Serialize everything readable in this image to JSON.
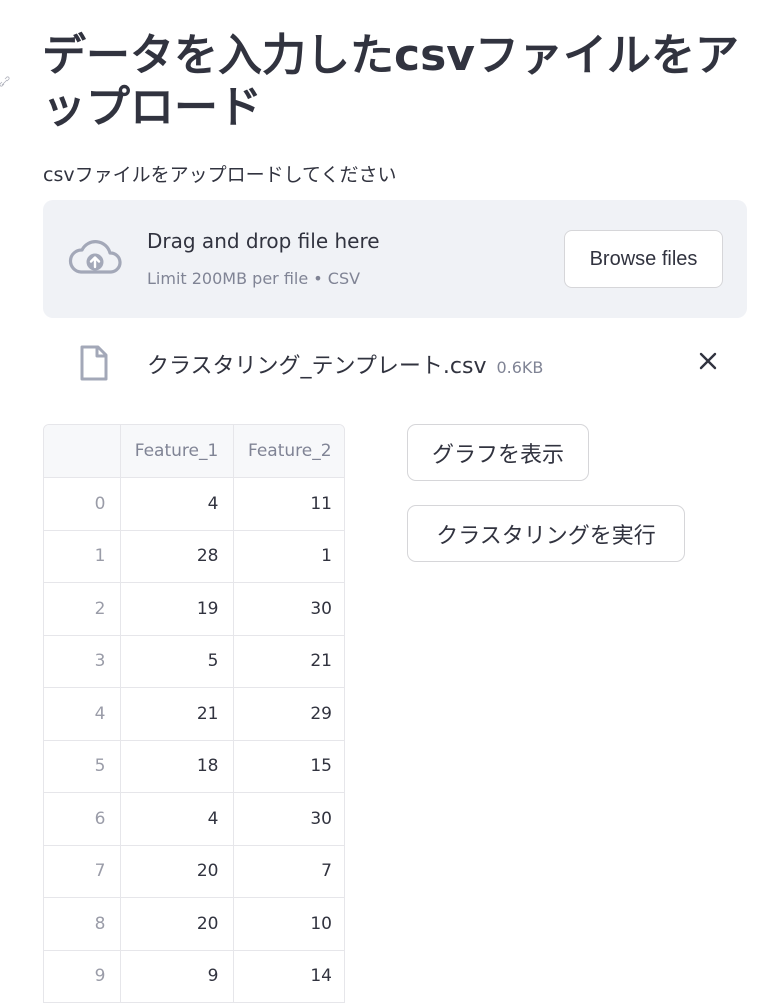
{
  "page": {
    "title": "データを入力したcsvファイルをアップロード"
  },
  "uploader": {
    "label": "csvファイルをアップロードしてください",
    "dropzone_title": "Drag and drop file here",
    "dropzone_limit": "Limit 200MB per file • CSV",
    "browse_label": "Browse files",
    "icon": "cloud-upload-icon"
  },
  "uploaded_file": {
    "name": "クラスタリング_テンプレート.csv",
    "size": "0.6KB",
    "icon": "file-icon",
    "remove_icon": "close-icon"
  },
  "dataframe": {
    "columns": [
      "",
      "Feature_1",
      "Feature_2"
    ],
    "rows": [
      {
        "index": "0",
        "feature_1": "4",
        "feature_2": "11"
      },
      {
        "index": "1",
        "feature_1": "28",
        "feature_2": "1"
      },
      {
        "index": "2",
        "feature_1": "19",
        "feature_2": "30"
      },
      {
        "index": "3",
        "feature_1": "5",
        "feature_2": "21"
      },
      {
        "index": "4",
        "feature_1": "21",
        "feature_2": "29"
      },
      {
        "index": "5",
        "feature_1": "18",
        "feature_2": "15"
      },
      {
        "index": "6",
        "feature_1": "4",
        "feature_2": "30"
      },
      {
        "index": "7",
        "feature_1": "20",
        "feature_2": "7"
      },
      {
        "index": "8",
        "feature_1": "20",
        "feature_2": "10"
      },
      {
        "index": "9",
        "feature_1": "9",
        "feature_2": "14"
      }
    ]
  },
  "actions": {
    "show_graph_label": "グラフを表示",
    "run_clustering_label": "クラスタリングを実行"
  },
  "colors": {
    "text": "#31333f",
    "muted": "#808495",
    "dropzone_bg": "#f0f2f6",
    "border": "#d6d6d9"
  }
}
